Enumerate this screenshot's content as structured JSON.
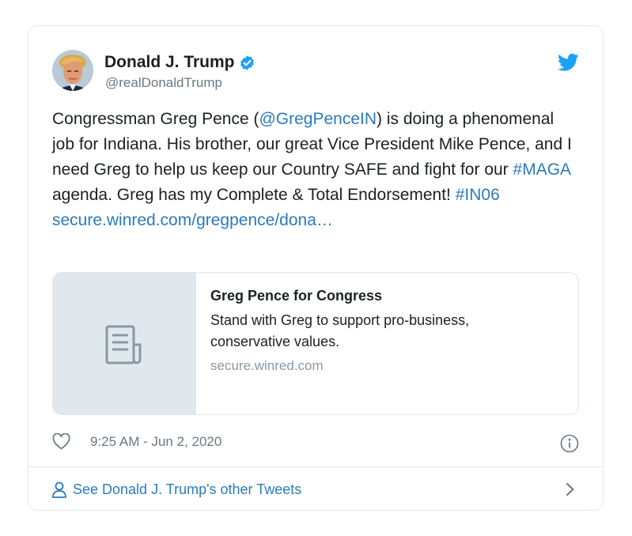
{
  "author": {
    "display_name": "Donald J. Trump",
    "handle": "@realDonaldTrump"
  },
  "icons": {
    "avatar": "profile-photo",
    "verified": "verified-badge-icon",
    "bird": "twitter-bird-icon",
    "card_thumb": "document-icon",
    "like": "heart-icon",
    "info": "info-icon",
    "user": "user-icon",
    "chevron": "chevron-right-icon"
  },
  "tweet": {
    "t1": "Congressman Greg Pence (",
    "mention": "@GregPenceIN",
    "t2": ") is doing a phenomenal job for Indiana. His brother, our great Vice President Mike Pence, and I need Greg to help us keep our Country SAFE and fight for our ",
    "hashtag1": "#MAGA",
    "t3": " agenda. Greg has my Complete & Total Endorsement! ",
    "hashtag2": "#IN06",
    "url": "secure.winred.com/gregpence/dona…"
  },
  "link_card": {
    "title": "Greg Pence for Congress",
    "description": "Stand with Greg to support pro-business, conservative values.",
    "domain": "secure.winred.com"
  },
  "meta": {
    "timestamp": "9:25 AM - Jun 2, 2020"
  },
  "footer": {
    "label": "See Donald J. Trump's other Tweets"
  },
  "colors": {
    "link": "#2b7bb9",
    "twitter_blue": "#1da1f2",
    "text": "#1c2022",
    "secondary": "#697882",
    "border": "#e1e8ed"
  }
}
